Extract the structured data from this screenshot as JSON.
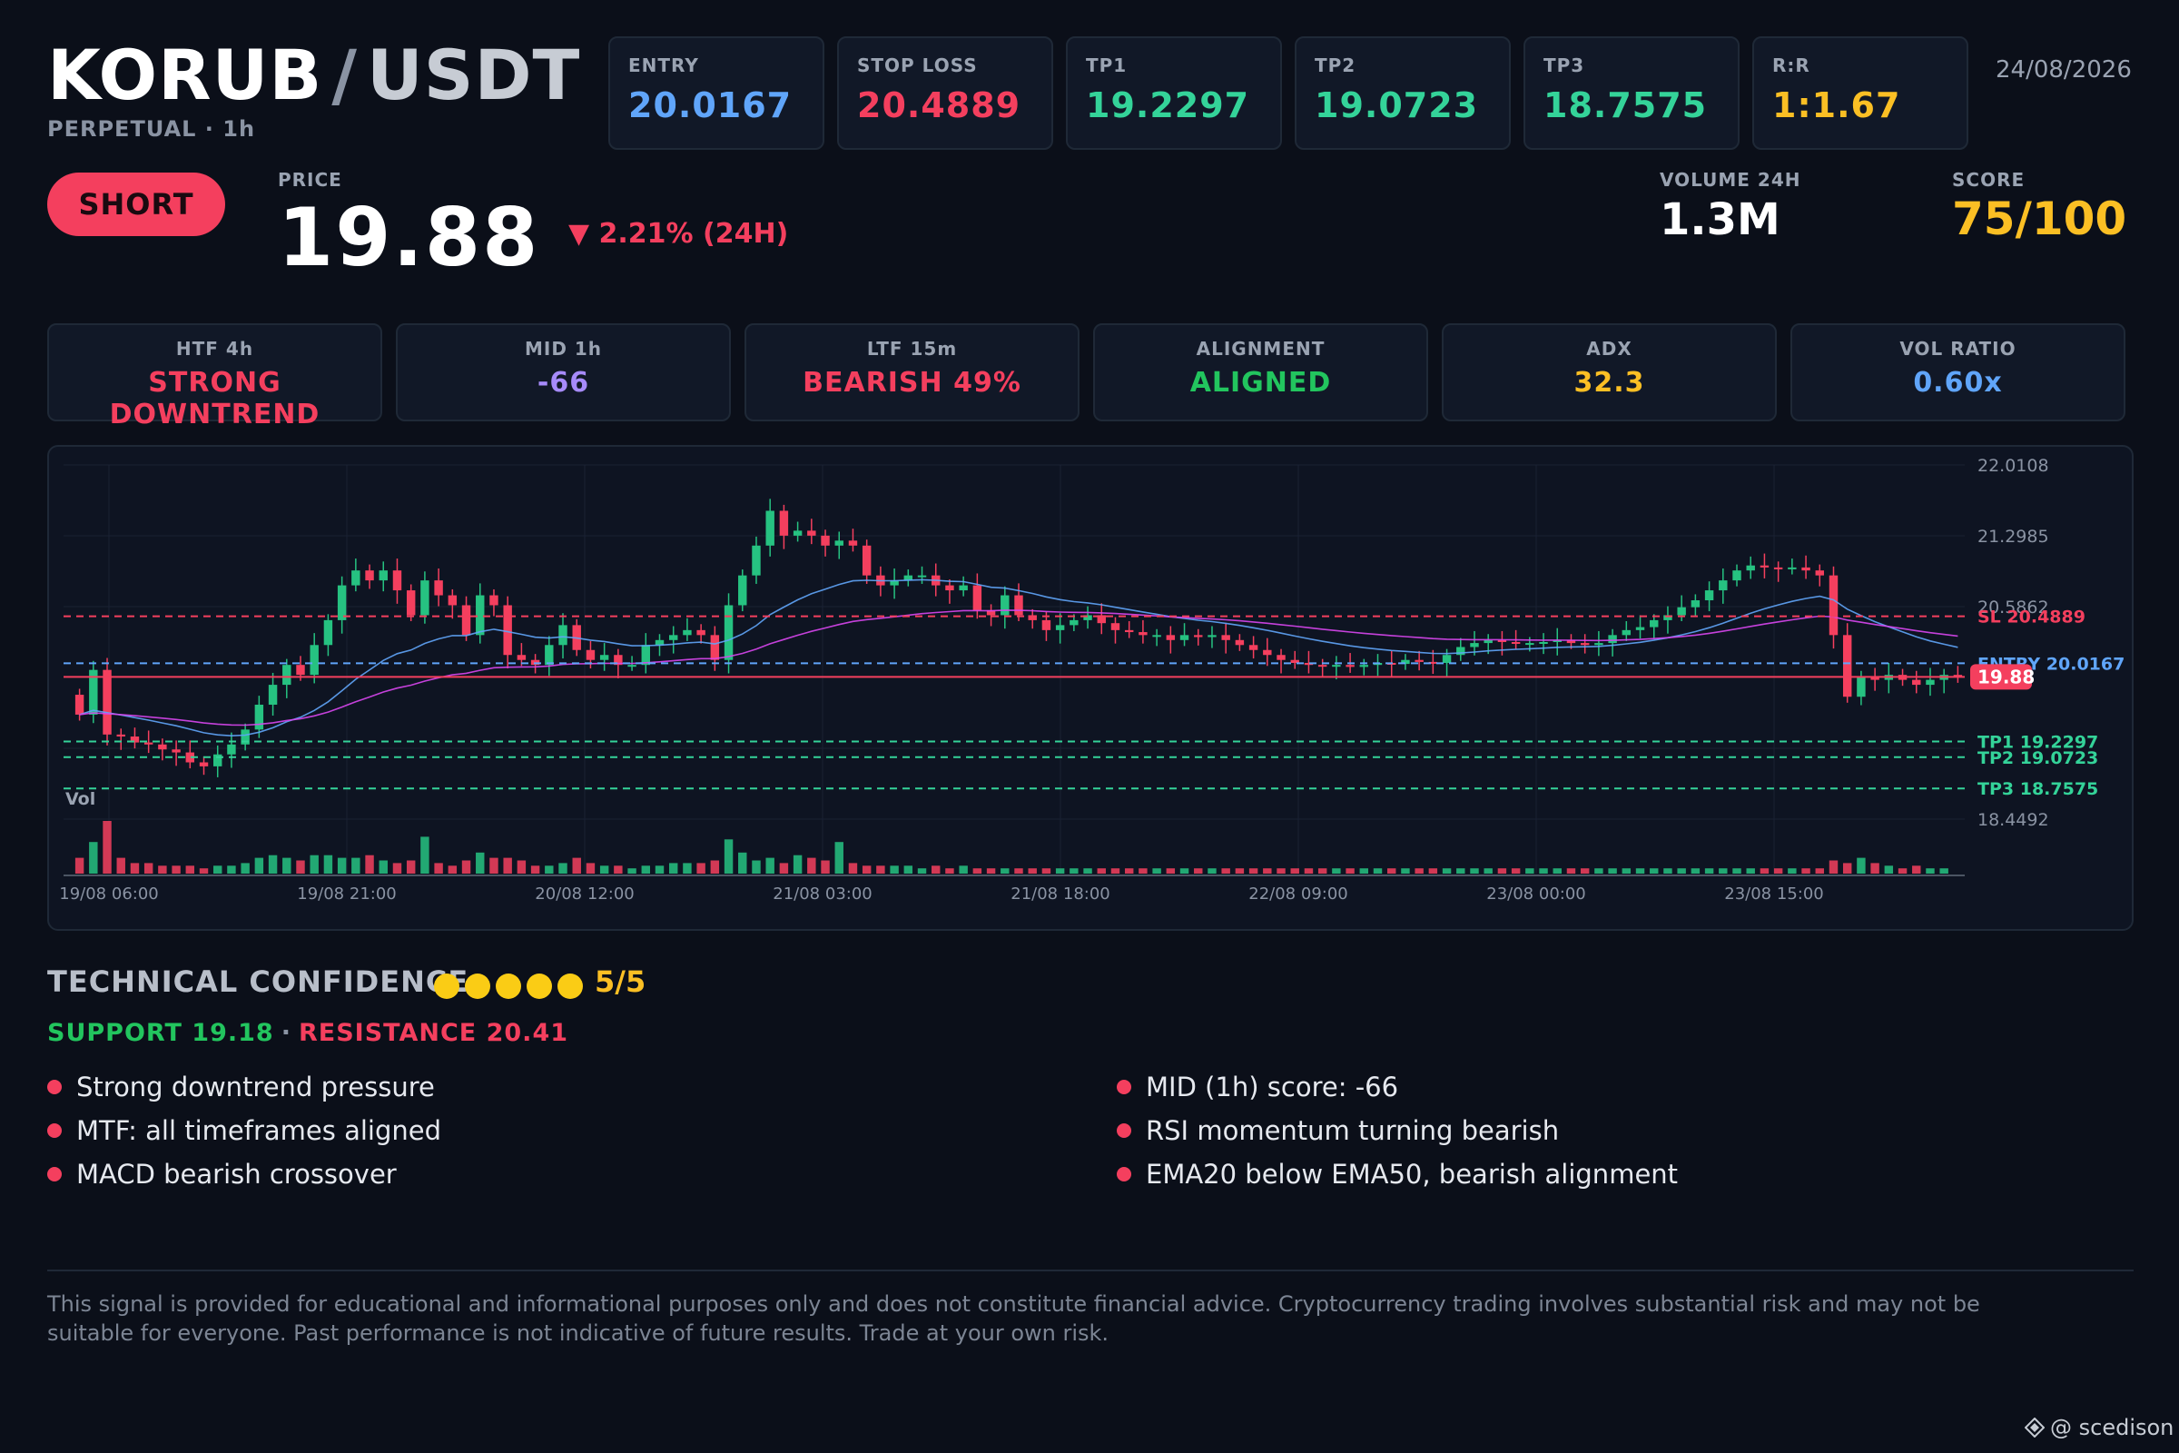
{
  "header": {
    "base": "KORUB",
    "slash": "/",
    "quote": "USDT",
    "subtitle": "PERPETUAL · 1h",
    "date": "24/08/2026"
  },
  "stats": [
    {
      "label": "ENTRY",
      "value": "20.0167",
      "color": "#60a5fa"
    },
    {
      "label": "STOP LOSS",
      "value": "20.4889",
      "color": "#f43f5e"
    },
    {
      "label": "TP1",
      "value": "19.2297",
      "color": "#34d399"
    },
    {
      "label": "TP2",
      "value": "19.0723",
      "color": "#34d399"
    },
    {
      "label": "TP3",
      "value": "18.7575",
      "color": "#34d399"
    },
    {
      "label": "R:R",
      "value": "1:1.67",
      "color": "#fbbf24"
    }
  ],
  "signal": {
    "side": "SHORT",
    "price_label": "PRICE",
    "price": "19.88",
    "change": "▼ 2.21% (24H)",
    "volume_label": "VOLUME 24H",
    "volume": "1.3M",
    "score_label": "SCORE",
    "score": "75/100"
  },
  "indicators": [
    {
      "label": "HTF 4h",
      "value": "STRONG DOWNTREND",
      "color": "#f43f5e"
    },
    {
      "label": "MID 1h",
      "value": "-66",
      "color": "#a78bfa"
    },
    {
      "label": "LTF 15m",
      "value": "BEARISH 49%",
      "color": "#f43f5e"
    },
    {
      "label": "ALIGNMENT",
      "value": "ALIGNED",
      "color": "#22c55e"
    },
    {
      "label": "ADX",
      "value": "32.3",
      "color": "#fbbf24"
    },
    {
      "label": "VOL RATIO",
      "value": "0.60x",
      "color": "#60a5fa"
    }
  ],
  "chart_data": {
    "type": "candlestick",
    "ylim": [
      18.4492,
      22.0108
    ],
    "y_tick_labels": [
      "22.0108",
      "21.2985",
      "20.5862",
      "18.4492"
    ],
    "x_tick_labels": [
      "19/08 06:00",
      "19/08 21:00",
      "20/08 12:00",
      "21/08 03:00",
      "21/08 18:00",
      "22/08 09:00",
      "23/08 00:00",
      "23/08 15:00"
    ],
    "volume_label": "Vol",
    "levels": [
      {
        "name": "SL",
        "label": "SL 20.4889",
        "value": 20.4889,
        "color": "#f43f5e",
        "style": "dashed"
      },
      {
        "name": "ENTRY",
        "label": "ENTRY 20.0167",
        "value": 20.0167,
        "color": "#60a5fa",
        "style": "dashed"
      },
      {
        "name": "PRICE",
        "label": "19.88",
        "value": 19.88,
        "color": "#f43f5e",
        "style": "solid"
      },
      {
        "name": "TP1",
        "label": "TP1 19.2297",
        "value": 19.2297,
        "color": "#34d399",
        "style": "dashed"
      },
      {
        "name": "TP2",
        "label": "TP2 19.0723",
        "value": 19.0723,
        "color": "#34d399",
        "style": "dashed"
      },
      {
        "name": "TP3",
        "label": "TP3 18.7575",
        "value": 18.7575,
        "color": "#34d399",
        "style": "dashed"
      }
    ],
    "close": [
      19.5,
      19.95,
      19.3,
      19.28,
      19.22,
      19.2,
      19.15,
      19.12,
      19.02,
      18.98,
      19.1,
      19.2,
      19.35,
      19.6,
      19.8,
      20.0,
      19.9,
      20.2,
      20.45,
      20.8,
      20.95,
      20.85,
      20.95,
      20.75,
      20.5,
      20.85,
      20.7,
      20.6,
      20.3,
      20.7,
      20.6,
      20.1,
      20.05,
      20.0,
      20.2,
      20.4,
      20.15,
      20.05,
      20.1,
      20.0,
      20.0,
      20.2,
      20.25,
      20.3,
      20.35,
      20.3,
      20.05,
      20.6,
      20.9,
      21.2,
      21.55,
      21.3,
      21.35,
      21.3,
      21.2,
      21.25,
      21.2,
      20.9,
      20.8,
      20.85,
      20.9,
      20.9,
      20.8,
      20.75,
      20.8,
      20.55,
      20.5,
      20.7,
      20.5,
      20.45,
      20.35,
      20.4,
      20.45,
      20.5,
      20.42,
      20.35,
      20.33,
      20.3,
      20.3,
      20.25,
      20.3,
      20.28,
      20.3,
      20.25,
      20.2,
      20.15,
      20.1,
      20.05,
      20.02,
      20.0,
      19.99,
      20.0,
      19.98,
      20.0,
      20.02,
      20.01,
      20.05,
      20.03,
      20.02,
      20.1,
      20.18,
      20.22,
      20.25,
      20.23,
      20.22,
      20.22,
      20.23,
      20.25,
      20.22,
      20.2,
      20.22,
      20.3,
      20.35,
      20.38,
      20.45,
      20.5,
      20.58,
      20.65,
      20.75,
      20.85,
      20.95,
      21.0,
      20.98,
      20.97,
      20.98,
      20.95,
      20.9,
      20.3,
      19.68,
      19.88,
      19.85,
      19.9,
      19.85,
      19.8,
      19.85,
      19.9,
      19.88
    ],
    "volume_scale": "relative",
    "volumes": [
      0.3,
      0.6,
      1.0,
      0.3,
      0.2,
      0.2,
      0.15,
      0.15,
      0.15,
      0.1,
      0.15,
      0.15,
      0.2,
      0.3,
      0.35,
      0.3,
      0.25,
      0.35,
      0.35,
      0.3,
      0.3,
      0.35,
      0.25,
      0.2,
      0.25,
      0.7,
      0.2,
      0.15,
      0.25,
      0.4,
      0.3,
      0.3,
      0.25,
      0.15,
      0.15,
      0.2,
      0.3,
      0.2,
      0.15,
      0.15,
      0.1,
      0.15,
      0.15,
      0.2,
      0.2,
      0.2,
      0.25,
      0.65,
      0.4,
      0.25,
      0.3,
      0.2,
      0.35,
      0.3,
      0.25,
      0.6,
      0.2,
      0.15,
      0.15,
      0.15,
      0.15,
      0.1,
      0.15,
      0.1,
      0.15,
      0.1,
      0.1,
      0.1,
      0.1,
      0.1,
      0.1,
      0.1,
      0.1,
      0.1,
      0.1,
      0.1,
      0.1,
      0.1,
      0.1,
      0.1,
      0.1,
      0.1,
      0.1,
      0.1,
      0.1,
      0.1,
      0.1,
      0.1,
      0.1,
      0.1,
      0.1,
      0.1,
      0.1,
      0.1,
      0.1,
      0.1,
      0.1,
      0.1,
      0.1,
      0.1,
      0.1,
      0.1,
      0.1,
      0.1,
      0.1,
      0.1,
      0.1,
      0.1,
      0.1,
      0.1,
      0.1,
      0.1,
      0.1,
      0.1,
      0.1,
      0.1,
      0.1,
      0.1,
      0.1,
      0.1,
      0.1,
      0.1,
      0.1,
      0.1,
      0.1,
      0.1,
      0.1,
      0.25,
      0.2,
      0.3,
      0.2,
      0.15,
      0.1,
      0.15,
      0.1,
      0.1
    ]
  },
  "confidence": {
    "title": "TECHNICAL CONFIDENCE",
    "filled": 5,
    "total": 5,
    "score": "5/5",
    "support": "SUPPORT 19.18",
    "separator": "·",
    "resistance": "RESISTANCE 20.41"
  },
  "bullets_left": [
    "Strong downtrend pressure",
    "MTF: all timeframes aligned",
    "MACD bearish crossover"
  ],
  "bullets_right": [
    "MID (1h) score: -66",
    "RSI momentum turning bearish",
    "EMA20 below EMA50, bearish alignment"
  ],
  "disclaimer": "This signal is provided for educational and informational purposes only and does not constitute financial advice. Cryptocurrency trading involves substantial risk and may not be suitable for everyone. Past performance is not indicative of future results. Trade at your own risk.",
  "watermark": "@ scedison",
  "colors": {
    "bull": "#26c281",
    "bear": "#f43f5e",
    "ema_fast": "#60a5fa",
    "ema_slow": "#d946ef"
  }
}
